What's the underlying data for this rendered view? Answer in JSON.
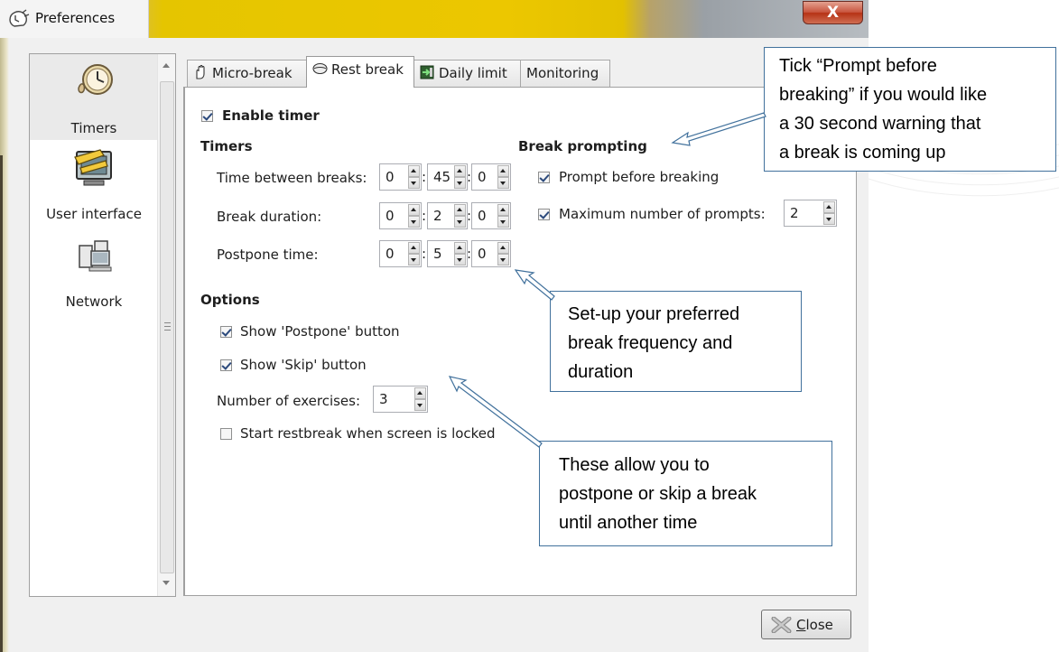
{
  "window": {
    "title": "Preferences",
    "close_glyph": "X"
  },
  "sidebar": {
    "items": [
      {
        "label": "Timers",
        "icon": "clock-icon",
        "selected": true
      },
      {
        "label": "User interface",
        "icon": "ruler-monitor-icon",
        "selected": false
      },
      {
        "label": "Network",
        "icon": "network-computers-icon",
        "selected": false
      }
    ]
  },
  "tabs": [
    {
      "label": "Micro-break",
      "icon": "hand-icon",
      "active": false
    },
    {
      "label": "Rest break",
      "icon": "bed-icon",
      "active": true
    },
    {
      "label": "Daily limit",
      "icon": "exit-icon",
      "active": false
    },
    {
      "label": "Monitoring",
      "icon": "",
      "active": false
    }
  ],
  "panel": {
    "enable_timer": {
      "label": "Enable timer",
      "checked": true
    },
    "timers": {
      "heading": "Timers",
      "rows": [
        {
          "label": "Time between breaks:",
          "hours": "0",
          "minutes": "45",
          "seconds": "0"
        },
        {
          "label": "Break duration:",
          "hours": "0",
          "minutes": "2",
          "seconds": "0"
        },
        {
          "label": "Postpone time:",
          "hours": "0",
          "minutes": "5",
          "seconds": "0"
        }
      ],
      "separator": ":"
    },
    "break_prompting": {
      "heading": "Break prompting",
      "prompt_before": {
        "label": "Prompt before breaking",
        "checked": true
      },
      "max_prompts": {
        "label": "Maximum number of prompts:",
        "checked": true,
        "value": "2"
      }
    },
    "options": {
      "heading": "Options",
      "show_postpone": {
        "label": "Show 'Postpone' button",
        "checked": true
      },
      "show_skip": {
        "label": "Show 'Skip' button",
        "checked": true
      },
      "num_exercises": {
        "label": "Number of exercises:",
        "value": "3"
      },
      "start_locked": {
        "label": "Start restbreak when screen is locked",
        "checked": false
      }
    }
  },
  "footer": {
    "close_label_first": "C",
    "close_label_rest": "lose"
  },
  "callouts": {
    "prompt": [
      "Tick “Prompt before",
      "breaking” if you would like",
      "a 30 second warning that",
      "a break is coming up"
    ],
    "frequency": [
      "Set-up your preferred",
      "break frequency and",
      "duration"
    ],
    "postpone": [
      "These allow you to",
      "postpone or skip a break",
      "until another time"
    ]
  },
  "colors": {
    "title_gold": "#ecc700",
    "callout_border": "#41719c",
    "checkmark": "#2c4a7c"
  }
}
